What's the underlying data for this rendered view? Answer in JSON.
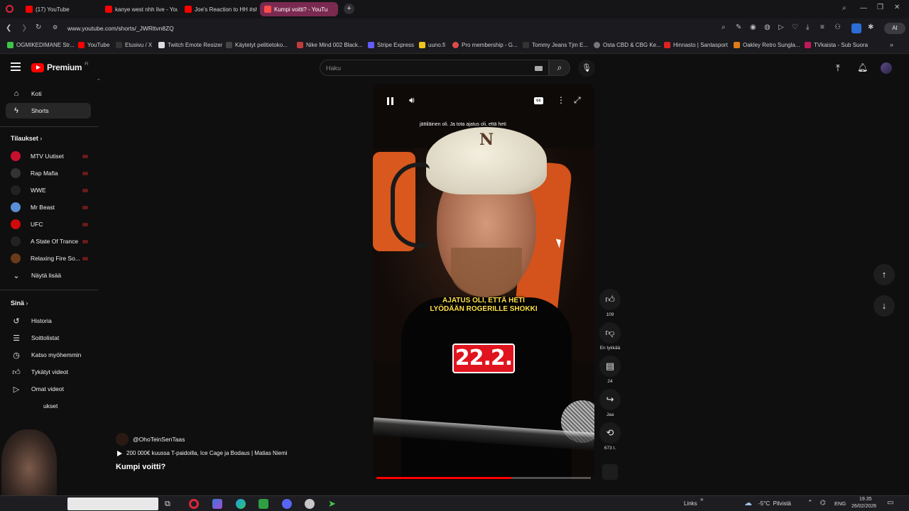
{
  "browser": {
    "tabs": [
      {
        "title": "(17) YouTube",
        "active": false
      },
      {
        "title": "kanye west nhh live - You",
        "active": false
      },
      {
        "title": "Joe's Reaction to HH #sh",
        "active": false
      },
      {
        "title": "Kumpi voitti? - YouTu",
        "active": true
      }
    ],
    "url": "www.youtube.com/shorts/_JWRltvn8ZQ",
    "ai_label": "AI",
    "bookmarks": [
      "OGMIKEDIMANE Str...",
      "YouTube",
      "Etusivu / X",
      "Twitch Emote Resizer",
      "Käytetyt pelitietoko...",
      "Nike Mind 002 Black...",
      "Stripe Express",
      "uuno.fi",
      "Pro membership - G...",
      "Tommy Jeans Tjm E...",
      "Osta CBD & CBG Ke...",
      "Hinnasto | Santasport",
      "Oakley Retro Sungla...",
      "TVkaista - Sub Suora"
    ]
  },
  "yt": {
    "logo": "Premium",
    "logo_sup": "FI",
    "search_placeholder": "Haku",
    "nav": [
      {
        "label": "Koti",
        "icon": "home-icon"
      },
      {
        "label": "Shorts",
        "icon": "shorts-icon"
      }
    ],
    "subs_title": "Tilaukset",
    "subscriptions": [
      {
        "name": "MTV Uutiset",
        "color": "#c8102e"
      },
      {
        "name": "Rap Mafia",
        "color": "#333333"
      },
      {
        "name": "WWE",
        "color": "#222222"
      },
      {
        "name": "Mr Beast",
        "color": "#5a8fd6"
      },
      {
        "name": "UFC",
        "color": "#d20a0a"
      },
      {
        "name": "A State Of Trance",
        "color": "#222222"
      },
      {
        "name": "Relaxing Fire So...",
        "color": "#6b3a1a"
      }
    ],
    "show_more": "Näytä lisää",
    "you_title": "Sinä",
    "you_items": [
      {
        "label": "Historia"
      },
      {
        "label": "Soittolistat"
      },
      {
        "label": "Katso myöhemmin"
      },
      {
        "label": "Tykätyt videot"
      },
      {
        "label": "Omat videot"
      },
      {
        "label": "ukset"
      }
    ],
    "channel": "@OhoTeinSenTaas",
    "related": "200 000€ kuussa T-paidoilla, Ice Cage ja Bodaus | Matias Niemi",
    "short_title": "Kumpi voitti?",
    "caption_top": "jättiläinen oli. Ja tota ajatus oli, että heti",
    "caption_main1": "AJATUS OLI, ETTÄ HETI",
    "caption_main2": "LYÖDÄÄN ROGERILLE SHOKKI",
    "date_badge": "22.2.",
    "progress": 0.63,
    "actions": [
      {
        "name": "like",
        "label": "109"
      },
      {
        "name": "dislike",
        "label": "En tykkää"
      },
      {
        "name": "comments",
        "label": "24"
      },
      {
        "name": "share",
        "label": "Jaa"
      },
      {
        "name": "remix",
        "label": "673 t."
      }
    ]
  },
  "taskbar": {
    "links": "Links",
    "weather": "-5°C  Pilvistä",
    "lang": "ENG",
    "time": "19.35",
    "date": "26/02/2026"
  },
  "colors": {
    "accent": "#ff0000",
    "tab_active": "#7a2a50",
    "caption_yellow": "#ffe14a"
  }
}
